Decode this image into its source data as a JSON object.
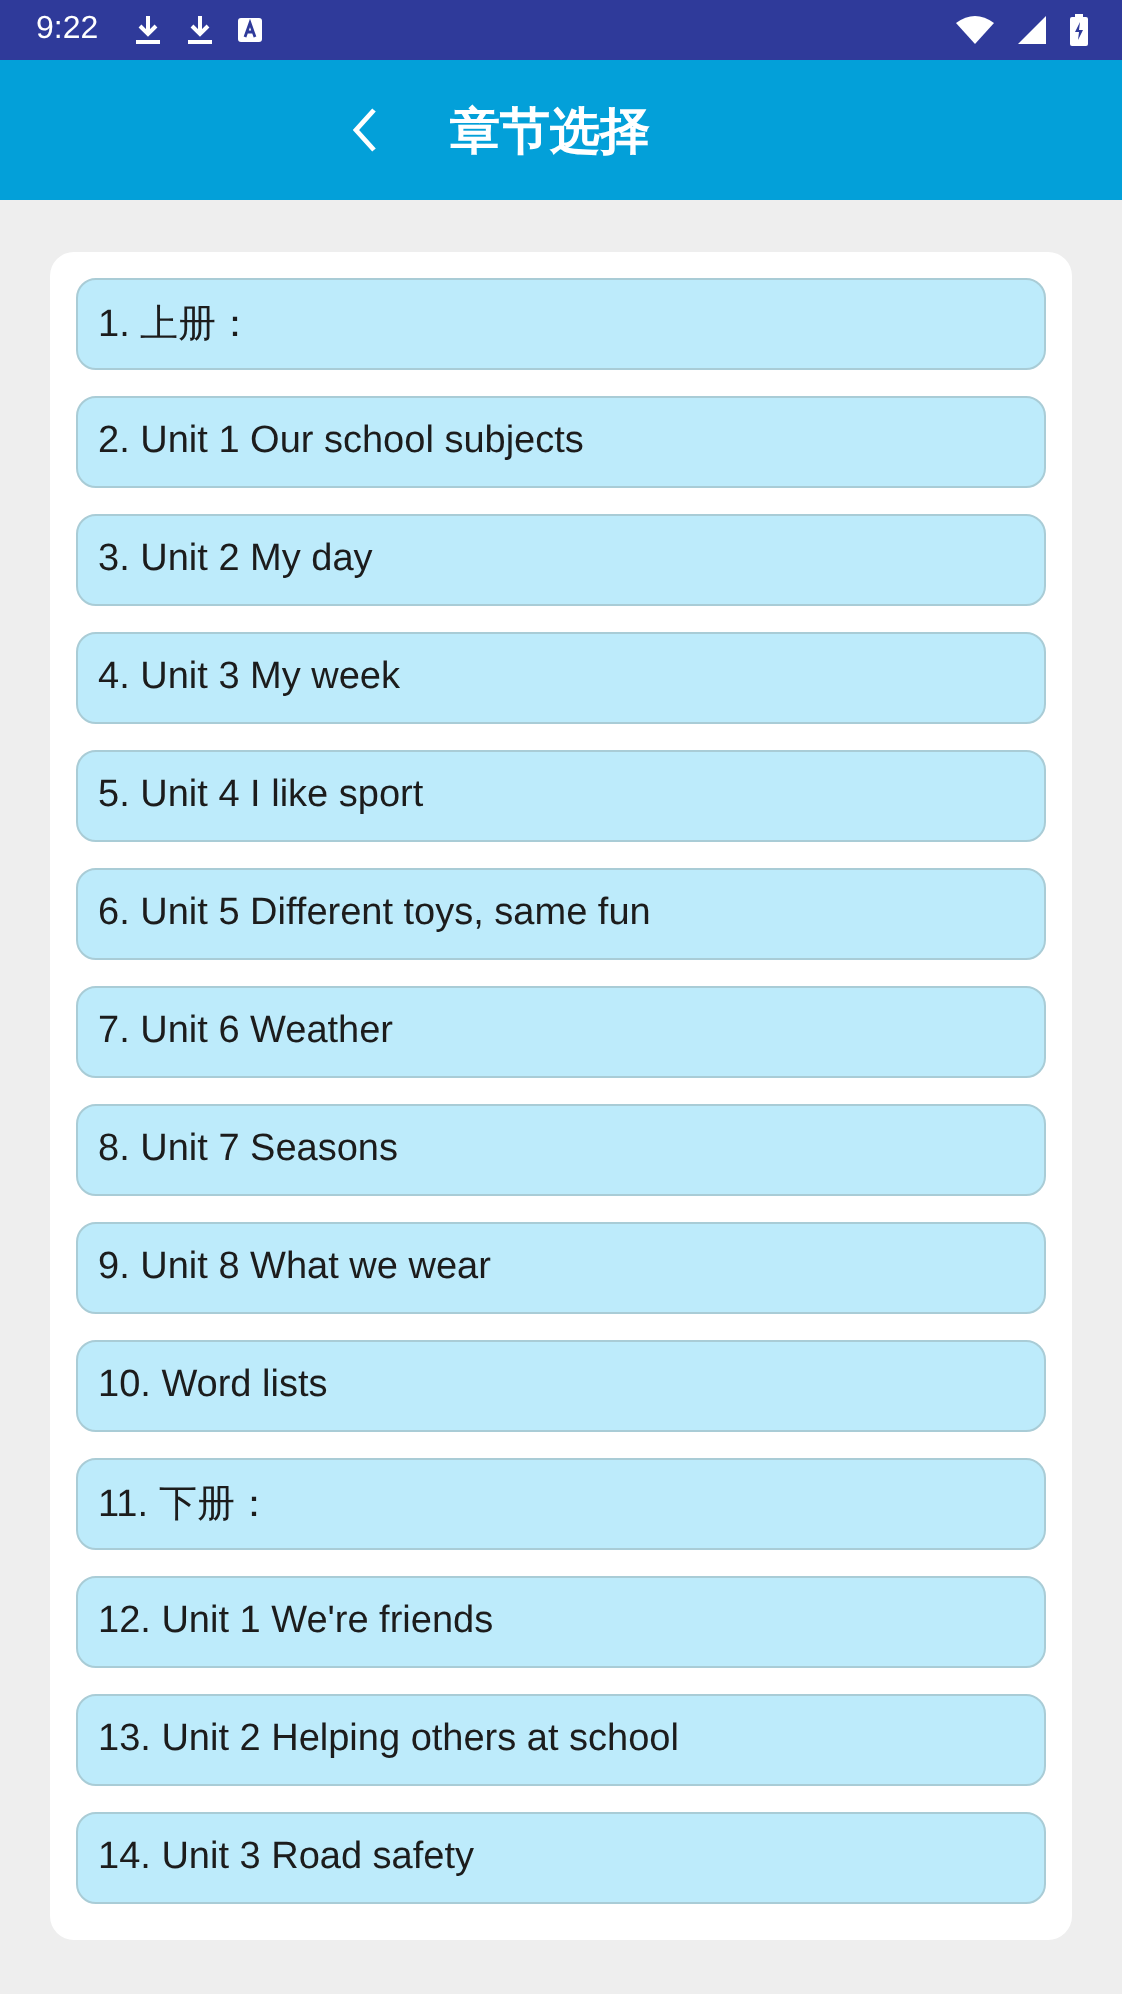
{
  "status_bar": {
    "time": "9:22"
  },
  "header": {
    "title": "章节选择"
  },
  "chapters": [
    "1. 上册：",
    "2. Unit 1 Our school subjects",
    "3. Unit 2 My day",
    "4. Unit 3 My week",
    "5. Unit 4 I like sport",
    "6. Unit 5 Different toys, same fun",
    "7. Unit 6 Weather",
    "8. Unit 7 Seasons",
    "9. Unit 8 What we wear",
    "10. Word lists",
    "11. 下册：",
    "12. Unit 1 We're friends",
    "13. Unit 2 Helping others at school",
    "14. Unit 3 Road safety"
  ]
}
